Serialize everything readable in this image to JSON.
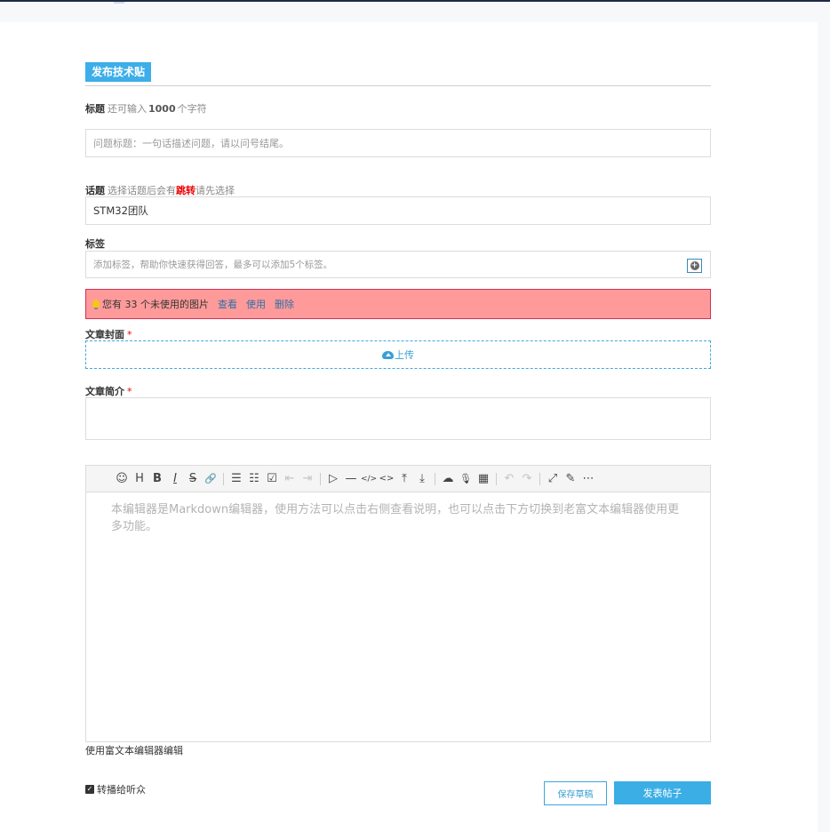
{
  "header": {
    "title": "发布技术贴"
  },
  "title_field": {
    "label": "标题",
    "hint_prefix": "还可输入",
    "char_count": "1000",
    "hint_suffix": "个字符",
    "placeholder": "问题标题：一句话描述问题，请以问号结尾。",
    "value": ""
  },
  "topic_field": {
    "label": "话题",
    "hint_prefix": "选择话题后会有",
    "hint_highlight": "跳转",
    "hint_suffix": "请先选择",
    "value": "STM32团队"
  },
  "tags_field": {
    "label": "标签",
    "placeholder": "添加标签，帮助你快速获得回答，最多可以添加5个标签。",
    "add_icon": "plus-circle-icon"
  },
  "unused_images_alert": {
    "text": "您有 33 个未使用的图片",
    "view_link": "查看",
    "use_link": "使用",
    "delete_link": "删除",
    "icon": "lightbulb-icon"
  },
  "cover": {
    "label": "文章封面",
    "required_mark": "*",
    "upload_label": "上传",
    "upload_icon": "cloud-upload-icon"
  },
  "intro": {
    "label": "文章简介",
    "required_mark": "*",
    "value": ""
  },
  "editor": {
    "placeholder": "本编辑器是Markdown编辑器，使用方法可以点击右侧查看说明，也可以点击下方切换到老富文本编辑器使用更多功能。",
    "toolbar": {
      "emoji": "☺",
      "heading": "H",
      "bold": "B",
      "italic": "I",
      "strike": "S",
      "link": "🔗",
      "ul": "☰",
      "ol": "☷",
      "checklist": "☑",
      "outdent": "⇤",
      "indent": "⇥",
      "quote": "▷",
      "hr": "—",
      "code": "</>",
      "inline_code": "<>",
      "upload_top": "⤒",
      "upload_bottom": "⤓",
      "upload": "☁",
      "record": "🎙",
      "table": "▦",
      "undo": "↶",
      "redo": "↷",
      "fullscreen": "⤢",
      "edit_mode": "✎",
      "more": "⋯"
    }
  },
  "switch_editor_link": "使用富文本编辑器编辑",
  "repost": {
    "label": "转播给听众",
    "checked": true
  },
  "actions": {
    "save_draft": "保存草稿",
    "publish": "发表帖子"
  },
  "colors": {
    "accent": "#3daee9",
    "alert_bg": "#ff9a9a",
    "alert_border": "#cc3355",
    "required": "#ee0000"
  }
}
